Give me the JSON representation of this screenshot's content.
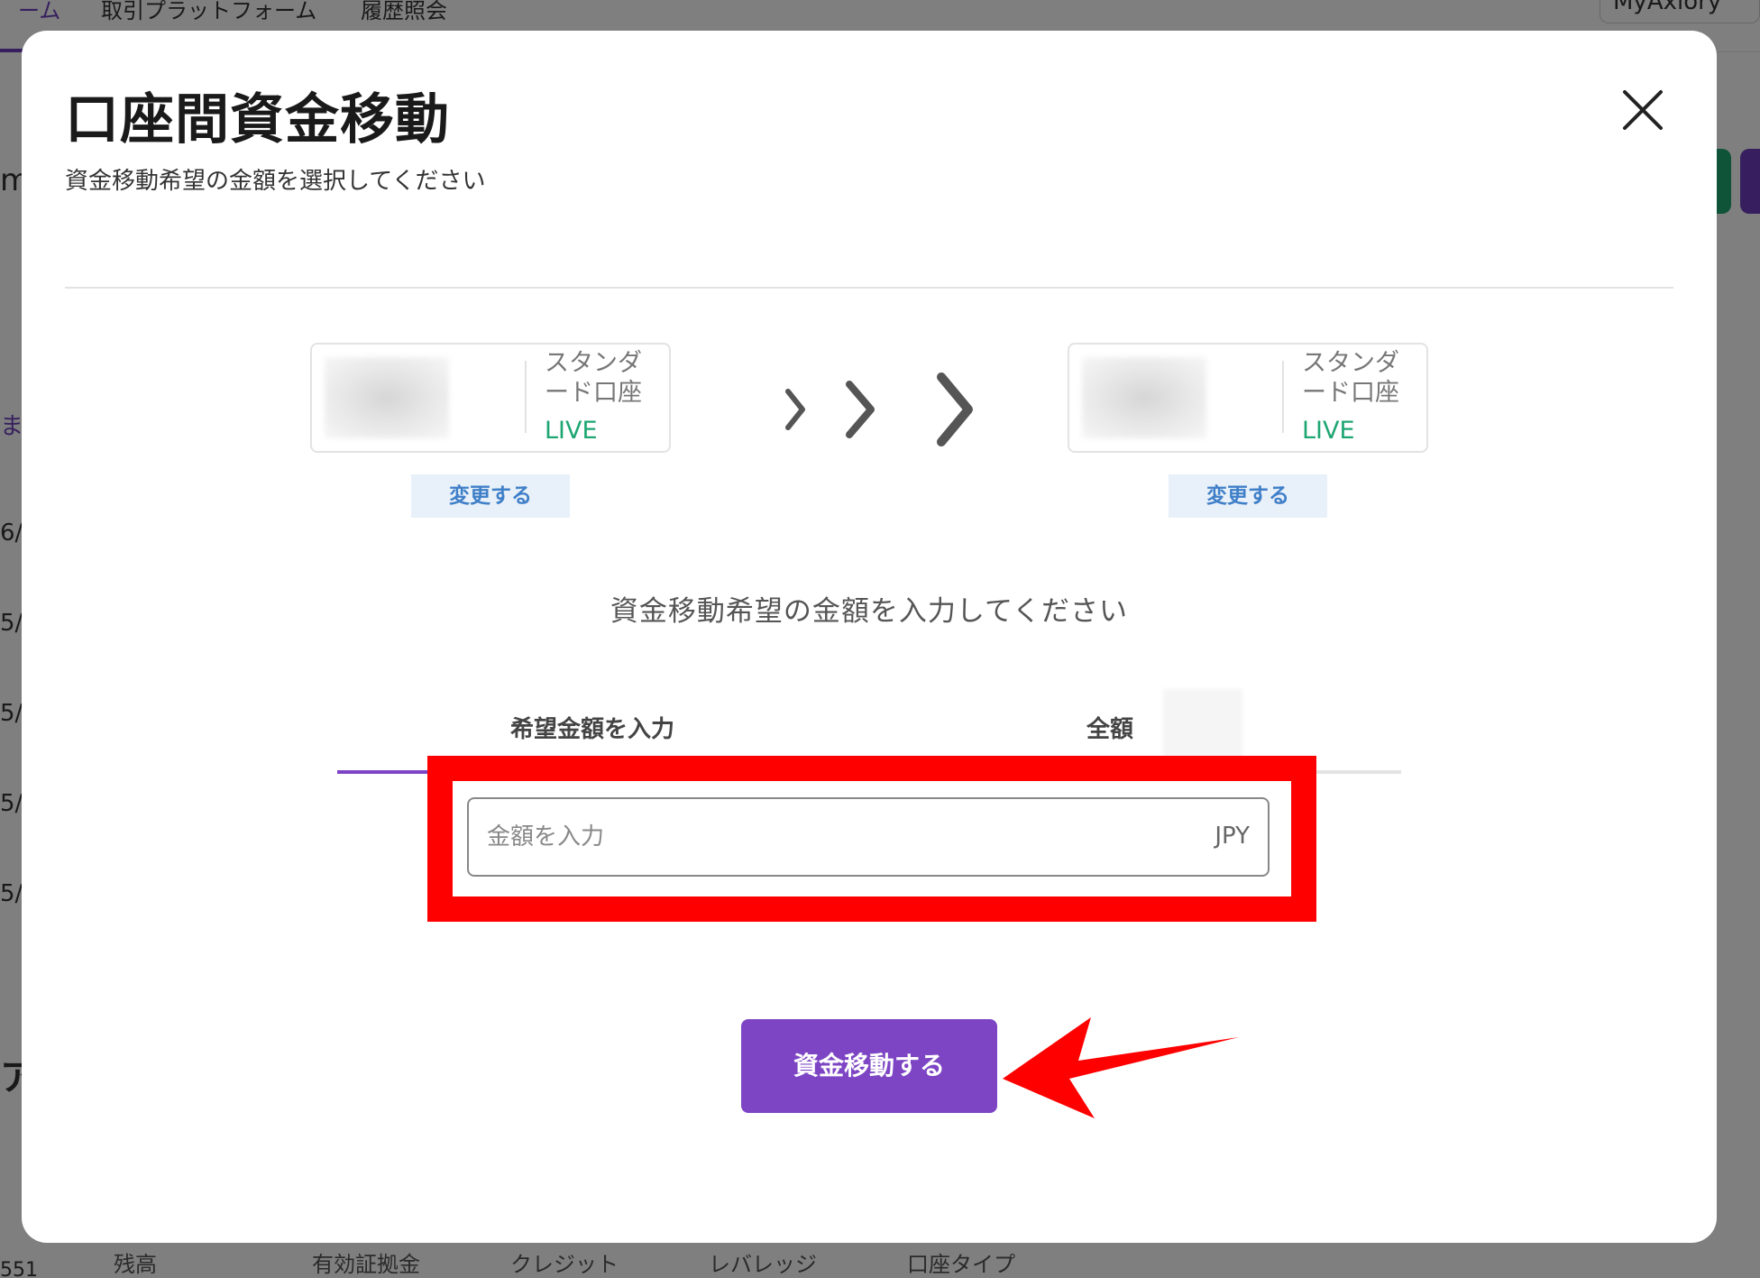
{
  "background": {
    "nav_items": [
      "ーム",
      "取引プラットフォーム",
      "履歴照会"
    ],
    "account_button": "MyAxiory",
    "left_fragments": [
      "m",
      "ま",
      "6/",
      "5/",
      "5/",
      "5/",
      "5/",
      "ア",
      "551"
    ],
    "footer_columns": [
      "残高",
      "有効証拠金",
      "クレジット",
      "レバレッジ",
      "口座タイプ"
    ]
  },
  "modal": {
    "title": "口座間資金移動",
    "subtitle": "資金移動希望の金額を選択してください",
    "close_icon": "close-icon",
    "from_account": {
      "type": "スタンダード口座",
      "status": "LIVE",
      "change_label": "変更する"
    },
    "to_account": {
      "type": "スタンダード口座",
      "status": "LIVE",
      "change_label": "変更する"
    },
    "transfer_icon": "chevrons-right-icon",
    "amount_prompt": "資金移動希望の金額を入力してください",
    "tabs": [
      {
        "label": "希望金額を入力",
        "active": true
      },
      {
        "label": "全額",
        "active": false
      }
    ],
    "amount_input": {
      "placeholder": "金額を入力",
      "value": "",
      "currency": "JPY"
    },
    "submit_label": "資金移動する"
  },
  "colors": {
    "accent_purple": "#7d45c4",
    "live_green": "#1ea672",
    "link_blue": "#3f7fc8",
    "annotation_red": "#ff0000"
  }
}
